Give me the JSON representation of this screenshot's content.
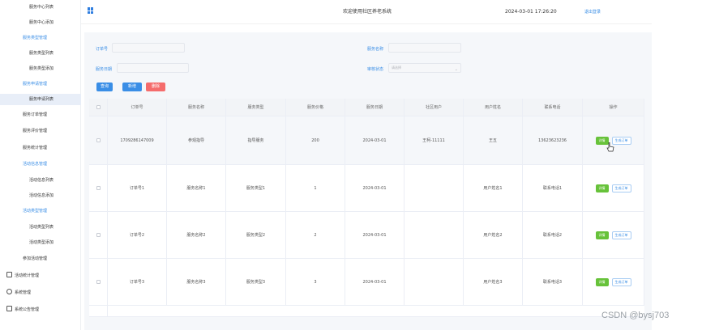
{
  "sidebar": {
    "items": [
      {
        "label": "服务中心列表",
        "kind": "sub"
      },
      {
        "label": "服务中心添加",
        "kind": "sub"
      },
      {
        "label": "服务类型管理",
        "kind": "group"
      },
      {
        "label": "服务类型列表",
        "kind": "sub"
      },
      {
        "label": "服务类型添加",
        "kind": "sub"
      },
      {
        "label": "服务申请管理",
        "kind": "group"
      },
      {
        "label": "服务申请列表",
        "kind": "sub-active"
      },
      {
        "label": "服务订单管理",
        "kind": "top"
      },
      {
        "label": "服务评价管理",
        "kind": "top"
      },
      {
        "label": "服务统计管理",
        "kind": "top"
      },
      {
        "label": "活动信息管理",
        "kind": "group"
      },
      {
        "label": "活动信息列表",
        "kind": "sub"
      },
      {
        "label": "活动信息添加",
        "kind": "sub"
      },
      {
        "label": "活动类型管理",
        "kind": "group"
      },
      {
        "label": "活动类型列表",
        "kind": "sub"
      },
      {
        "label": "活动类型添加",
        "kind": "sub"
      },
      {
        "label": "参加活动管理",
        "kind": "top"
      },
      {
        "label": "活动统计管理",
        "kind": "icon",
        "icon": "document-icon"
      },
      {
        "label": "系统管理",
        "kind": "icon",
        "icon": "gear-icon"
      },
      {
        "label": "系统公告管理",
        "kind": "icon",
        "icon": "monitor-icon"
      }
    ]
  },
  "header": {
    "welcome": "欢迎使用社区养老系统",
    "datetime": "2024-03-01 17:26:20",
    "logout": "退出登录"
  },
  "search": {
    "order_no_label": "订单号",
    "order_no_value": "",
    "service_name_label": "服务名称",
    "service_name_value": "",
    "service_date_label": "服务日期",
    "service_date_value": "",
    "review_status_label": "审核状态",
    "review_status_placeholder": "请选择",
    "query_btn": "查询",
    "add_btn": "新增",
    "delete_btn": "删除"
  },
  "table": {
    "columns": [
      "订单号",
      "服务名称",
      "服务类型",
      "服务价格",
      "服务日期",
      "社区用户",
      "用户姓名",
      "联系电话",
      "操作"
    ],
    "rows": [
      [
        "1709286147009",
        "参观指导",
        "指导服务",
        "200",
        "2024-03-01",
        "王柯-11111",
        "王五",
        "13623623236"
      ],
      [
        "订单号1",
        "服务名称1",
        "服务类型1",
        "1",
        "2024-03-01",
        "",
        "用户姓名1",
        "联系电话1"
      ],
      [
        "订单号2",
        "服务名称2",
        "服务类型2",
        "2",
        "2024-03-01",
        "",
        "用户姓名2",
        "联系电话2"
      ],
      [
        "订单号3",
        "服务名称3",
        "服务类型3",
        "3",
        "2024-03-01",
        "",
        "用户姓名3",
        "联系电话3"
      ]
    ],
    "action_detail": "详情",
    "action_order": "生成订单"
  },
  "watermark": "CSDN @bysj703",
  "colors": {
    "accent": "#3a8ee6",
    "danger": "#f56c6c",
    "success": "#67c23a"
  }
}
